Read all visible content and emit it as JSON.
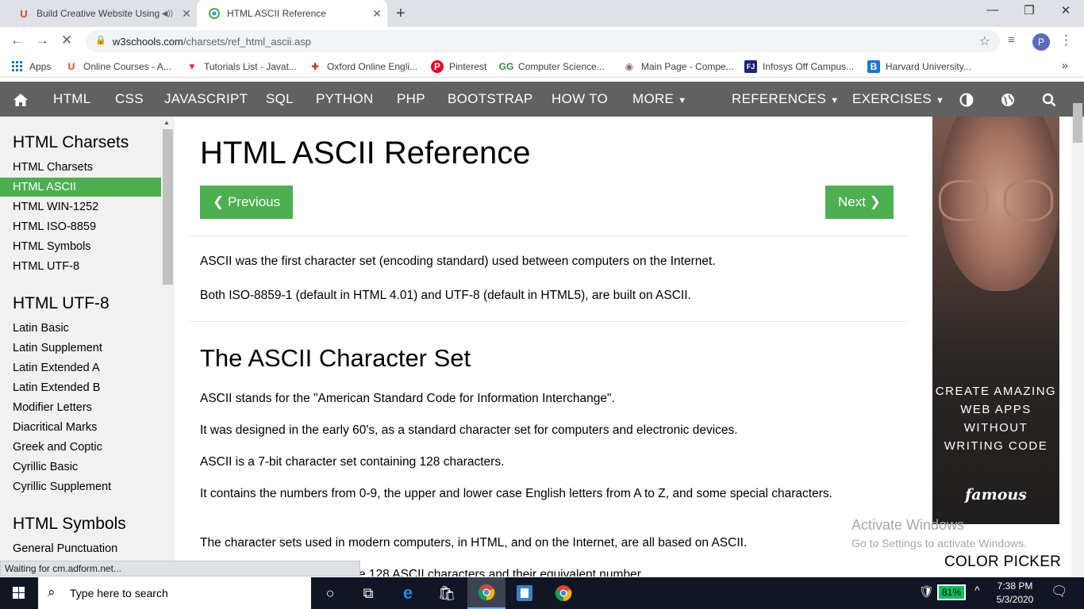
{
  "browser": {
    "tabs": [
      {
        "title": "Build Creative Website Using",
        "active": false
      },
      {
        "title": "HTML ASCII Reference",
        "active": true
      }
    ],
    "new_tab": "+",
    "url_host": "w3schools.com",
    "url_path": "/charsets/ref_html_ascii.asp",
    "profile_initial": "P",
    "bookmarks": [
      {
        "label": "Apps"
      },
      {
        "label": "Online Courses - A..."
      },
      {
        "label": "Tutorials List - Javat..."
      },
      {
        "label": "Oxford Online Engli..."
      },
      {
        "label": "Pinterest"
      },
      {
        "label": "Computer Science..."
      },
      {
        "label": "Main Page - Compe..."
      },
      {
        "label": "Infosys Off Campus..."
      },
      {
        "label": "Harvard University..."
      }
    ],
    "more_bookmarks": "»"
  },
  "nav": {
    "items": [
      "HTML",
      "CSS",
      "JAVASCRIPT",
      "SQL",
      "PYTHON",
      "PHP",
      "BOOTSTRAP",
      "HOW TO",
      "MORE",
      "REFERENCES",
      "EXERCISES"
    ],
    "accent": "#616161"
  },
  "sidebar": {
    "sections": [
      {
        "heading": "HTML Charsets",
        "items": [
          "HTML Charsets",
          "HTML ASCII",
          "HTML WIN-1252",
          "HTML ISO-8859",
          "HTML Symbols",
          "HTML UTF-8"
        ]
      },
      {
        "heading": "HTML UTF-8",
        "items": [
          "Latin Basic",
          "Latin Supplement",
          "Latin Extended A",
          "Latin Extended B",
          "Modifier Letters",
          "Diacritical Marks",
          "Greek and Coptic",
          "Cyrillic Basic",
          "Cyrillic Supplement"
        ]
      },
      {
        "heading": "HTML Symbols",
        "items": [
          "General Punctuation"
        ]
      }
    ],
    "active_item": "HTML ASCII",
    "active_color": "#4caf50"
  },
  "main": {
    "title": "HTML ASCII Reference",
    "prev_label": "❮ Previous",
    "next_label": "Next ❯",
    "intro": [
      "ASCII was the first character set (encoding standard) used between computers on the Internet.",
      "Both ISO-8859-1 (default in HTML 4.01) and UTF-8 (default in HTML5), are built on ASCII."
    ],
    "section_title": "The ASCII Character Set",
    "paragraphs": [
      "ASCII stands for the \"American Standard Code for Information Interchange\".",
      "It was designed in the early 60's, as a standard character set for computers and electronic devices.",
      "ASCII is a 7-bit character set containing 128 characters.",
      "It contains the numbers from 0-9, the upper and lower case English letters from A to Z, and some special characters.",
      "The character sets used in modern computers, in HTML, and on the Internet, are all based on ASCII."
    ],
    "cut_line": "e 128 ASCII characters and their equivalent number"
  },
  "ad": {
    "text": "CREATE AMAZING WEB APPS WITHOUT WRITING CODE",
    "brand": "famous",
    "color_picker": "COLOR PICKER"
  },
  "watermark": {
    "line1": "Activate Windows",
    "line2": "Go to Settings to activate Windows."
  },
  "status_text": "Waiting for cm.adform.net...",
  "taskbar": {
    "search_placeholder": "Type here to search",
    "battery": "81%",
    "time": "7:38 PM",
    "date": "5/3/2020"
  }
}
